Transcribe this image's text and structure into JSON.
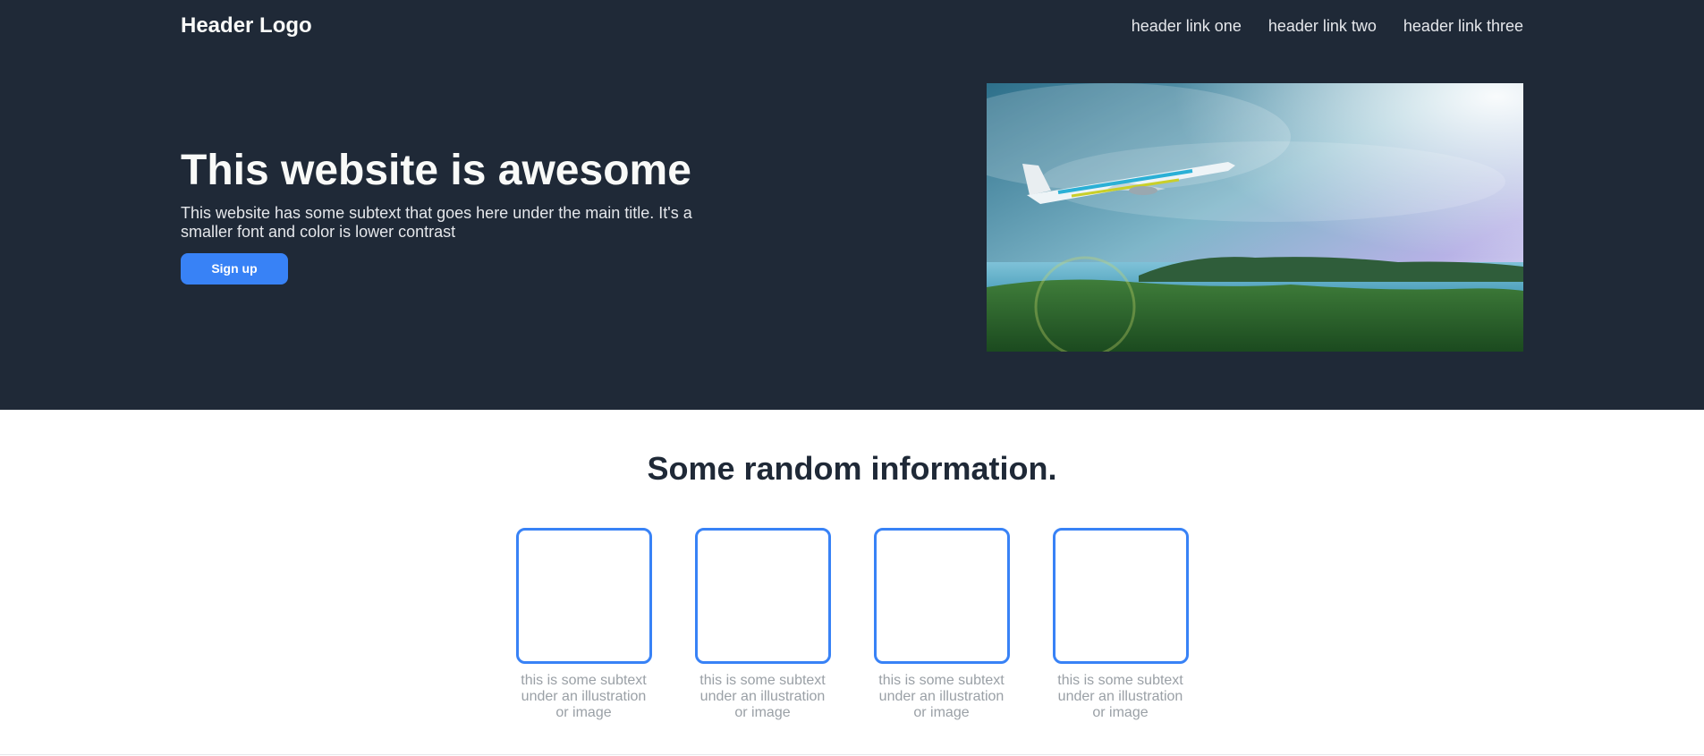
{
  "header": {
    "logo": "Header Logo",
    "links": [
      "header link one",
      "header link two",
      "header link three"
    ]
  },
  "hero": {
    "title": "This website is awesome",
    "subtitle": "This website has some subtext that goes here under the main title. It's a smaller font and color is lower contrast",
    "button_label": "Sign up",
    "image": "airplane-over-island-photo"
  },
  "info": {
    "title": "Some random information.",
    "cards": [
      {
        "text": "this is some subtext under an illustration or image"
      },
      {
        "text": "this is some subtext under an illustration or image"
      },
      {
        "text": "this is some subtext under an illustration or image"
      },
      {
        "text": "this is some subtext under an illustration or image"
      }
    ]
  },
  "colors": {
    "header_bg": "#1f2937",
    "accent": "#3882f6",
    "title_text": "#f9faf8",
    "muted_text": "#e5e7eb"
  }
}
